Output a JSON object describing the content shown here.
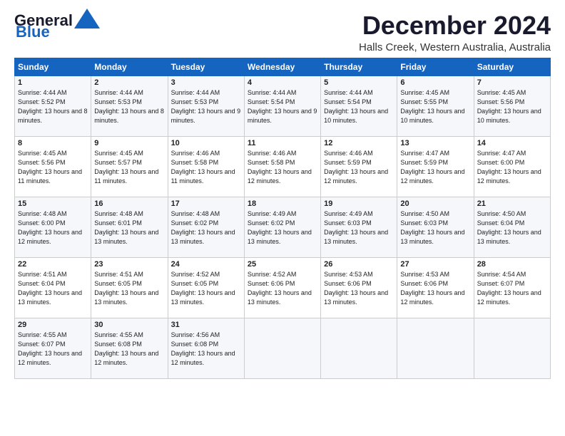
{
  "logo": {
    "line1": "General",
    "line2": "Blue"
  },
  "header": {
    "month": "December 2024",
    "location": "Halls Creek, Western Australia, Australia"
  },
  "weekdays": [
    "Sunday",
    "Monday",
    "Tuesday",
    "Wednesday",
    "Thursday",
    "Friday",
    "Saturday"
  ],
  "weeks": [
    [
      {
        "day": "1",
        "sunrise": "Sunrise: 4:44 AM",
        "sunset": "Sunset: 5:52 PM",
        "daylight": "Daylight: 13 hours and 8 minutes."
      },
      {
        "day": "2",
        "sunrise": "Sunrise: 4:44 AM",
        "sunset": "Sunset: 5:53 PM",
        "daylight": "Daylight: 13 hours and 8 minutes."
      },
      {
        "day": "3",
        "sunrise": "Sunrise: 4:44 AM",
        "sunset": "Sunset: 5:53 PM",
        "daylight": "Daylight: 13 hours and 9 minutes."
      },
      {
        "day": "4",
        "sunrise": "Sunrise: 4:44 AM",
        "sunset": "Sunset: 5:54 PM",
        "daylight": "Daylight: 13 hours and 9 minutes."
      },
      {
        "day": "5",
        "sunrise": "Sunrise: 4:44 AM",
        "sunset": "Sunset: 5:54 PM",
        "daylight": "Daylight: 13 hours and 10 minutes."
      },
      {
        "day": "6",
        "sunrise": "Sunrise: 4:45 AM",
        "sunset": "Sunset: 5:55 PM",
        "daylight": "Daylight: 13 hours and 10 minutes."
      },
      {
        "day": "7",
        "sunrise": "Sunrise: 4:45 AM",
        "sunset": "Sunset: 5:56 PM",
        "daylight": "Daylight: 13 hours and 10 minutes."
      }
    ],
    [
      {
        "day": "8",
        "sunrise": "Sunrise: 4:45 AM",
        "sunset": "Sunset: 5:56 PM",
        "daylight": "Daylight: 13 hours and 11 minutes."
      },
      {
        "day": "9",
        "sunrise": "Sunrise: 4:45 AM",
        "sunset": "Sunset: 5:57 PM",
        "daylight": "Daylight: 13 hours and 11 minutes."
      },
      {
        "day": "10",
        "sunrise": "Sunrise: 4:46 AM",
        "sunset": "Sunset: 5:58 PM",
        "daylight": "Daylight: 13 hours and 11 minutes."
      },
      {
        "day": "11",
        "sunrise": "Sunrise: 4:46 AM",
        "sunset": "Sunset: 5:58 PM",
        "daylight": "Daylight: 13 hours and 12 minutes."
      },
      {
        "day": "12",
        "sunrise": "Sunrise: 4:46 AM",
        "sunset": "Sunset: 5:59 PM",
        "daylight": "Daylight: 13 hours and 12 minutes."
      },
      {
        "day": "13",
        "sunrise": "Sunrise: 4:47 AM",
        "sunset": "Sunset: 5:59 PM",
        "daylight": "Daylight: 13 hours and 12 minutes."
      },
      {
        "day": "14",
        "sunrise": "Sunrise: 4:47 AM",
        "sunset": "Sunset: 6:00 PM",
        "daylight": "Daylight: 13 hours and 12 minutes."
      }
    ],
    [
      {
        "day": "15",
        "sunrise": "Sunrise: 4:48 AM",
        "sunset": "Sunset: 6:00 PM",
        "daylight": "Daylight: 13 hours and 12 minutes."
      },
      {
        "day": "16",
        "sunrise": "Sunrise: 4:48 AM",
        "sunset": "Sunset: 6:01 PM",
        "daylight": "Daylight: 13 hours and 13 minutes."
      },
      {
        "day": "17",
        "sunrise": "Sunrise: 4:48 AM",
        "sunset": "Sunset: 6:02 PM",
        "daylight": "Daylight: 13 hours and 13 minutes."
      },
      {
        "day": "18",
        "sunrise": "Sunrise: 4:49 AM",
        "sunset": "Sunset: 6:02 PM",
        "daylight": "Daylight: 13 hours and 13 minutes."
      },
      {
        "day": "19",
        "sunrise": "Sunrise: 4:49 AM",
        "sunset": "Sunset: 6:03 PM",
        "daylight": "Daylight: 13 hours and 13 minutes."
      },
      {
        "day": "20",
        "sunrise": "Sunrise: 4:50 AM",
        "sunset": "Sunset: 6:03 PM",
        "daylight": "Daylight: 13 hours and 13 minutes."
      },
      {
        "day": "21",
        "sunrise": "Sunrise: 4:50 AM",
        "sunset": "Sunset: 6:04 PM",
        "daylight": "Daylight: 13 hours and 13 minutes."
      }
    ],
    [
      {
        "day": "22",
        "sunrise": "Sunrise: 4:51 AM",
        "sunset": "Sunset: 6:04 PM",
        "daylight": "Daylight: 13 hours and 13 minutes."
      },
      {
        "day": "23",
        "sunrise": "Sunrise: 4:51 AM",
        "sunset": "Sunset: 6:05 PM",
        "daylight": "Daylight: 13 hours and 13 minutes."
      },
      {
        "day": "24",
        "sunrise": "Sunrise: 4:52 AM",
        "sunset": "Sunset: 6:05 PM",
        "daylight": "Daylight: 13 hours and 13 minutes."
      },
      {
        "day": "25",
        "sunrise": "Sunrise: 4:52 AM",
        "sunset": "Sunset: 6:06 PM",
        "daylight": "Daylight: 13 hours and 13 minutes."
      },
      {
        "day": "26",
        "sunrise": "Sunrise: 4:53 AM",
        "sunset": "Sunset: 6:06 PM",
        "daylight": "Daylight: 13 hours and 13 minutes."
      },
      {
        "day": "27",
        "sunrise": "Sunrise: 4:53 AM",
        "sunset": "Sunset: 6:06 PM",
        "daylight": "Daylight: 13 hours and 12 minutes."
      },
      {
        "day": "28",
        "sunrise": "Sunrise: 4:54 AM",
        "sunset": "Sunset: 6:07 PM",
        "daylight": "Daylight: 13 hours and 12 minutes."
      }
    ],
    [
      {
        "day": "29",
        "sunrise": "Sunrise: 4:55 AM",
        "sunset": "Sunset: 6:07 PM",
        "daylight": "Daylight: 13 hours and 12 minutes."
      },
      {
        "day": "30",
        "sunrise": "Sunrise: 4:55 AM",
        "sunset": "Sunset: 6:08 PM",
        "daylight": "Daylight: 13 hours and 12 minutes."
      },
      {
        "day": "31",
        "sunrise": "Sunrise: 4:56 AM",
        "sunset": "Sunset: 6:08 PM",
        "daylight": "Daylight: 13 hours and 12 minutes."
      },
      null,
      null,
      null,
      null
    ]
  ]
}
